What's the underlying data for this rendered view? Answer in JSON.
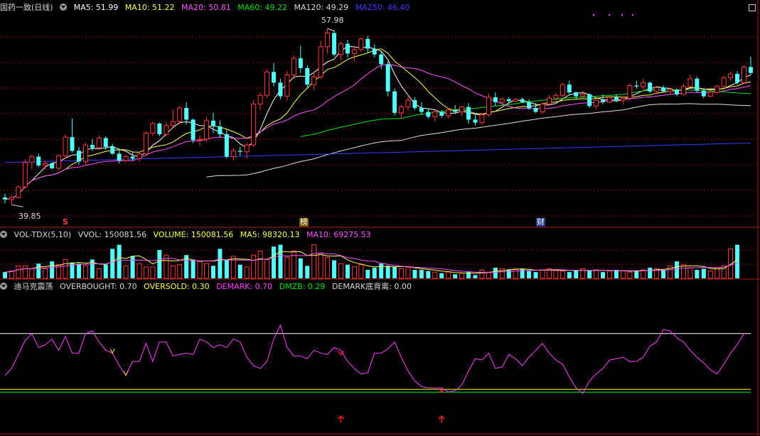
{
  "main_header": {
    "stock_name": "国药一致(日线)",
    "ma5": "MA5: 51.99",
    "ma10": "MA10: 51.22",
    "ma20": "MA20: 50.81",
    "ma60": "MA60: 49.22",
    "ma120": "MA120: 49.29",
    "ma250": "MA250: 46.40"
  },
  "vol_header": {
    "name": "VOL-TDX(5,10)",
    "vvol": "VVOL: 150081.56",
    "volume": "VOLUME: 150081.56",
    "ma5": "MA5: 98320.13",
    "ma10": "MA10: 69275.53"
  },
  "ind_header": {
    "name": "迪马克震荡",
    "overbought": "OVERBOUGHT: 0.70",
    "oversold": "OVERSOLD: 0.30",
    "demark": "DEMARK: 0.70",
    "dmzb": "DMZB: 0.29",
    "divergence": "DEMARK底背离: 0.00"
  },
  "markers": {
    "high": "57.98",
    "low": "39.85",
    "s_mark": "S",
    "bang_mark": "榜",
    "cai_mark": "财"
  },
  "colors": {
    "up": "#ff3c3c",
    "down": "#54ffff",
    "ma5": "#ffffff",
    "ma10": "#ffff54",
    "ma20": "#ff54ff",
    "ma60": "#00e600",
    "ma120": "#e0e0e0",
    "ma250": "#3c3cff",
    "demark": "#ff40ff",
    "overbought": "#ffffff",
    "oversold": "#ffff00",
    "dmzb": "#00ff00"
  },
  "chart_data": [
    {
      "type": "candlestick",
      "title": "国药一致(日线)",
      "ylim": [
        39,
        59
      ],
      "price_high": 57.98,
      "price_low": 39.85,
      "ohlc": [
        [
          40.6,
          41.0,
          40.0,
          40.4
        ],
        [
          40.4,
          40.8,
          39.85,
          40.6
        ],
        [
          40.6,
          41.8,
          40.5,
          41.7
        ],
        [
          41.7,
          44.5,
          41.5,
          44.2
        ],
        [
          44.2,
          45.0,
          43.5,
          44.8
        ],
        [
          44.8,
          45.1,
          43.7,
          43.9
        ],
        [
          43.9,
          44.4,
          43.5,
          44.1
        ],
        [
          44.1,
          44.2,
          43.5,
          43.6
        ],
        [
          43.6,
          45.0,
          43.4,
          44.9
        ],
        [
          44.9,
          47.1,
          44.6,
          46.8
        ],
        [
          46.8,
          48.7,
          45.2,
          45.4
        ],
        [
          45.4,
          45.8,
          44.0,
          44.3
        ],
        [
          44.3,
          46.2,
          44.0,
          46.0
        ],
        [
          46.0,
          46.6,
          45.4,
          45.7
        ],
        [
          45.7,
          47.0,
          45.5,
          46.7
        ],
        [
          46.7,
          46.9,
          45.5,
          45.8
        ],
        [
          45.8,
          46.1,
          45.0,
          45.1
        ],
        [
          45.1,
          45.6,
          44.1,
          44.4
        ],
        [
          44.4,
          45.0,
          44.2,
          44.8
        ],
        [
          44.8,
          45.3,
          44.4,
          44.6
        ],
        [
          44.6,
          45.3,
          44.3,
          45.1
        ],
        [
          45.1,
          47.4,
          44.9,
          47.2
        ],
        [
          47.2,
          48.4,
          46.9,
          48.2
        ],
        [
          48.2,
          48.3,
          46.9,
          47.1
        ],
        [
          47.1,
          48.4,
          46.8,
          48.0
        ],
        [
          48.0,
          49.6,
          47.8,
          48.4
        ],
        [
          48.4,
          50.0,
          48.1,
          49.8
        ],
        [
          49.8,
          50.4,
          48.1,
          48.6
        ],
        [
          48.6,
          48.7,
          46.2,
          46.5
        ],
        [
          46.5,
          47.0,
          45.9,
          46.6
        ],
        [
          46.6,
          48.9,
          46.3,
          48.5
        ],
        [
          48.5,
          49.3,
          47.2,
          47.9
        ],
        [
          47.9,
          48.5,
          46.8,
          47.1
        ],
        [
          47.1,
          47.6,
          44.6,
          44.8
        ],
        [
          44.8,
          45.7,
          44.4,
          45.4
        ],
        [
          45.4,
          45.8,
          44.9,
          45.3
        ],
        [
          45.3,
          46.2,
          44.6,
          46.0
        ],
        [
          46.0,
          50.6,
          45.8,
          50.2
        ],
        [
          50.2,
          51.4,
          49.6,
          51.1
        ],
        [
          51.1,
          53.8,
          50.8,
          53.5
        ],
        [
          53.5,
          54.4,
          52.0,
          52.4
        ],
        [
          52.4,
          52.8,
          50.7,
          51.0
        ],
        [
          51.0,
          53.6,
          50.6,
          53.2
        ],
        [
          53.2,
          55.2,
          52.8,
          54.9
        ],
        [
          54.9,
          56.2,
          53.4,
          53.9
        ],
        [
          53.9,
          54.2,
          51.8,
          52.2
        ],
        [
          52.2,
          53.6,
          51.6,
          53.0
        ],
        [
          53.0,
          56.7,
          52.8,
          56.1
        ],
        [
          56.1,
          57.98,
          55.4,
          57.5
        ],
        [
          57.5,
          57.8,
          55.1,
          55.3
        ],
        [
          55.3,
          56.6,
          54.7,
          56.4
        ],
        [
          56.4,
          56.8,
          55.0,
          55.4
        ],
        [
          55.4,
          56.2,
          54.6,
          55.8
        ],
        [
          55.8,
          57.0,
          55.6,
          56.9
        ],
        [
          56.9,
          57.2,
          55.5,
          55.9
        ],
        [
          55.9,
          56.3,
          55.0,
          55.3
        ],
        [
          55.3,
          55.6,
          53.8,
          54.3
        ],
        [
          54.3,
          54.6,
          51.0,
          51.5
        ],
        [
          51.5,
          51.8,
          49.0,
          49.3
        ],
        [
          49.3,
          50.1,
          48.7,
          49.9
        ],
        [
          49.9,
          51.0,
          49.5,
          50.6
        ],
        [
          50.6,
          50.9,
          49.6,
          49.8
        ],
        [
          49.8,
          50.4,
          49.1,
          49.4
        ],
        [
          49.4,
          49.7,
          48.7,
          48.9
        ],
        [
          48.9,
          49.6,
          48.4,
          49.4
        ],
        [
          49.4,
          49.6,
          48.8,
          49.0
        ],
        [
          49.0,
          49.8,
          48.7,
          49.6
        ],
        [
          49.6,
          50.1,
          49.2,
          49.4
        ],
        [
          49.4,
          50.0,
          49.0,
          49.9
        ],
        [
          49.9,
          50.3,
          48.2,
          48.6
        ],
        [
          48.6,
          49.1,
          48.0,
          48.3
        ],
        [
          48.3,
          49.3,
          48.1,
          49.1
        ],
        [
          49.1,
          51.3,
          48.9,
          50.9
        ],
        [
          50.9,
          51.4,
          50.0,
          50.4
        ],
        [
          50.4,
          50.9,
          50.0,
          50.7
        ],
        [
          50.7,
          50.9,
          50.3,
          50.5
        ],
        [
          50.5,
          50.8,
          50.4,
          50.7
        ],
        [
          50.7,
          50.9,
          50.3,
          50.4
        ],
        [
          50.4,
          50.7,
          49.6,
          49.8
        ],
        [
          49.8,
          50.3,
          49.3,
          49.4
        ],
        [
          49.4,
          50.4,
          49.2,
          50.2
        ],
        [
          50.2,
          51.1,
          50.0,
          50.8
        ],
        [
          50.8,
          51.3,
          50.4,
          51.1
        ],
        [
          51.1,
          52.4,
          50.9,
          52.2
        ],
        [
          52.2,
          52.6,
          51.2,
          51.4
        ],
        [
          51.4,
          51.5,
          50.7,
          51.0
        ],
        [
          51.0,
          51.6,
          50.9,
          51.2
        ],
        [
          51.2,
          51.3,
          49.8,
          50.0
        ],
        [
          50.0,
          50.7,
          49.7,
          50.6
        ],
        [
          50.6,
          51.2,
          50.2,
          50.4
        ],
        [
          50.4,
          51.0,
          50.3,
          50.9
        ],
        [
          50.9,
          51.2,
          50.4,
          50.6
        ],
        [
          50.6,
          51.0,
          50.2,
          50.8
        ],
        [
          50.8,
          52.3,
          50.7,
          52.1
        ],
        [
          52.1,
          52.6,
          51.8,
          52.0
        ],
        [
          52.0,
          52.8,
          51.7,
          52.4
        ],
        [
          52.4,
          52.5,
          51.3,
          51.5
        ],
        [
          51.5,
          52.0,
          51.2,
          51.9
        ],
        [
          51.9,
          52.1,
          51.4,
          51.5
        ],
        [
          51.5,
          51.9,
          51.2,
          51.7
        ],
        [
          51.7,
          51.8,
          51.0,
          51.2
        ],
        [
          51.2,
          52.3,
          51.1,
          52.0
        ],
        [
          52.0,
          53.2,
          51.9,
          52.8
        ],
        [
          52.8,
          53.0,
          51.4,
          51.6
        ],
        [
          51.6,
          51.7,
          50.8,
          51.0
        ],
        [
          51.0,
          51.6,
          50.9,
          51.4
        ],
        [
          51.4,
          52.2,
          51.3,
          52.0
        ],
        [
          52.0,
          53.1,
          51.9,
          52.9
        ],
        [
          52.9,
          53.5,
          52.6,
          53.3
        ],
        [
          53.3,
          53.6,
          52.2,
          52.4
        ],
        [
          52.4,
          54.2,
          52.3,
          54.0
        ],
        [
          54.0,
          55.1,
          53.2,
          53.4
        ]
      ]
    },
    {
      "type": "bar",
      "title": "VOL-TDX(5,10)",
      "volume_ratio": [
        0.17,
        0.2,
        0.34,
        0.34,
        0.26,
        0.4,
        0.26,
        0.46,
        0.37,
        0.51,
        0.43,
        0.4,
        0.34,
        0.51,
        0.26,
        0.37,
        0.8,
        0.91,
        0.34,
        0.6,
        0.4,
        0.31,
        0.31,
        0.77,
        0.63,
        0.34,
        0.37,
        0.63,
        0.51,
        0.46,
        0.4,
        0.34,
        0.8,
        0.51,
        0.6,
        0.37,
        0.31,
        0.63,
        0.74,
        0.51,
        0.86,
        0.91,
        0.57,
        0.74,
        0.54,
        0.34,
        0.91,
        0.69,
        0.57,
        0.49,
        0.4,
        0.37,
        0.31,
        0.37,
        0.23,
        0.29,
        0.4,
        0.34,
        0.31,
        0.26,
        0.29,
        0.23,
        0.23,
        0.2,
        0.17,
        0.14,
        0.17,
        0.11,
        0.14,
        0.17,
        0.09,
        0.23,
        0.17,
        0.29,
        0.26,
        0.23,
        0.26,
        0.26,
        0.2,
        0.17,
        0.23,
        0.26,
        0.23,
        0.2,
        0.17,
        0.23,
        0.26,
        0.2,
        0.23,
        0.17,
        0.2,
        0.23,
        0.2,
        0.17,
        0.2,
        0.23,
        0.29,
        0.26,
        0.23,
        0.34,
        0.46,
        0.37,
        0.29,
        0.23,
        0.26,
        0.2,
        0.29,
        0.34,
        0.8,
        0.91
      ]
    },
    {
      "type": "line",
      "title": "迪马克震荡",
      "ylim": [
        0,
        1
      ],
      "overbought": 0.7,
      "oversold": 0.3,
      "demark": [
        0.4,
        0.45,
        0.55,
        0.65,
        0.7,
        0.6,
        0.62,
        0.66,
        0.58,
        0.68,
        0.56,
        0.56,
        0.7,
        0.72,
        0.64,
        0.58,
        0.56,
        0.47,
        0.4,
        0.5,
        0.5,
        0.63,
        0.5,
        0.64,
        0.64,
        0.54,
        0.55,
        0.56,
        0.55,
        0.66,
        0.64,
        0.6,
        0.62,
        0.6,
        0.66,
        0.64,
        0.53,
        0.47,
        0.45,
        0.5,
        0.66,
        0.76,
        0.6,
        0.54,
        0.54,
        0.52,
        0.58,
        0.56,
        0.55,
        0.6,
        0.58,
        0.5,
        0.45,
        0.41,
        0.42,
        0.56,
        0.56,
        0.59,
        0.64,
        0.53,
        0.43,
        0.36,
        0.32,
        0.31,
        0.31,
        0.31,
        0.28,
        0.29,
        0.33,
        0.43,
        0.52,
        0.51,
        0.56,
        0.45,
        0.46,
        0.55,
        0.52,
        0.47,
        0.53,
        0.58,
        0.63,
        0.56,
        0.51,
        0.48,
        0.39,
        0.31,
        0.27,
        0.36,
        0.41,
        0.45,
        0.51,
        0.52,
        0.53,
        0.5,
        0.5,
        0.53,
        0.61,
        0.64,
        0.73,
        0.72,
        0.67,
        0.64,
        0.58,
        0.53,
        0.49,
        0.44,
        0.41,
        0.48,
        0.56,
        0.62,
        0.7
      ],
      "sell_signals": [
        16,
        18
      ],
      "buy_signals": [
        50,
        65
      ]
    }
  ]
}
